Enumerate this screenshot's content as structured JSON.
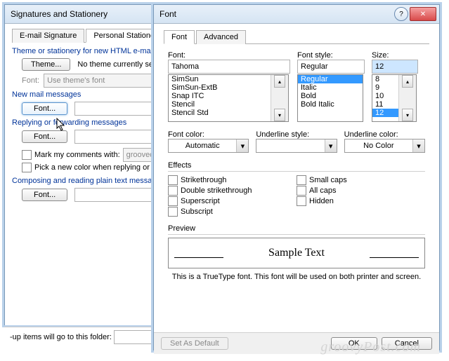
{
  "sigWindow": {
    "title": "Signatures and Stationery",
    "tabs": {
      "email": "E-mail Signature",
      "stationery": "Personal Stationery"
    },
    "themeLine": "Theme or stationery for new HTML e-mail m",
    "themeBtn": "Theme...",
    "noTheme": "No theme currently sele",
    "fontLbl": "Font:",
    "useTheme": "Use theme's font",
    "newMail": "New mail messages",
    "fontBtn": "Font...",
    "reply": "Replying or forwarding messages",
    "markComments": "Mark my comments with:",
    "markVal": "groovede",
    "pickColor": "Pick a new color when replying or for",
    "composing": "Composing and reading plain text message",
    "followup": "-up items will go to this folder:"
  },
  "fontWindow": {
    "title": "Font",
    "tabs": {
      "font": "Font",
      "advanced": "Advanced"
    },
    "fontLbl": "Font:",
    "fontVal": "Tahoma",
    "fontList": [
      "SimSun",
      "SimSun-ExtB",
      "Snap ITC",
      "Stencil",
      "Stencil Std"
    ],
    "styleLbl": "Font style:",
    "styleVal": "Regular",
    "styleList": [
      "Regular",
      "Italic",
      "Bold",
      "Bold Italic"
    ],
    "sizeLbl": "Size:",
    "sizeVal": "12",
    "sizeList": [
      "8",
      "9",
      "10",
      "11",
      "12"
    ],
    "colorLbl": "Font color:",
    "colorVal": "Automatic",
    "ulStyleLbl": "Underline style:",
    "ulColorLbl": "Underline color:",
    "ulColorVal": "No Color",
    "effectsLbl": "Effects",
    "effects": {
      "strike": "Strikethrough",
      "dstrike": "Double strikethrough",
      "superscript": "Superscript",
      "subscript": "Subscript",
      "smallcaps": "Small caps",
      "allcaps": "All caps",
      "hidden": "Hidden"
    },
    "previewLbl": "Preview",
    "previewText": "Sample Text",
    "note": "This is a TrueType font. This font will be used on both printer and screen.",
    "setDefault": "Set As Default",
    "ok": "OK",
    "cancel": "Cancel"
  },
  "watermark": "groovyPost.com"
}
